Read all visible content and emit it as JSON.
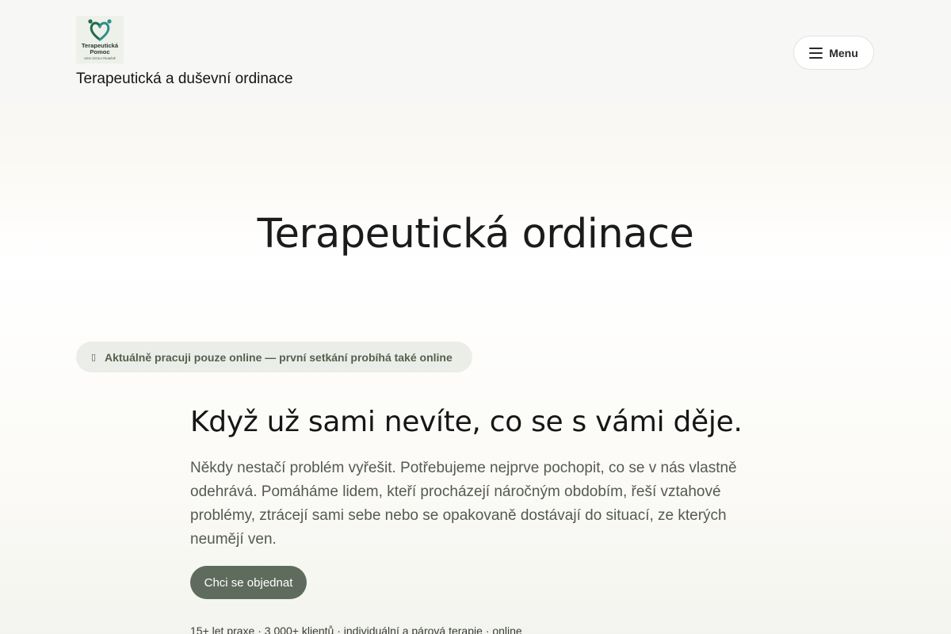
{
  "header": {
    "logo_icon": "heart-people-logo",
    "logo_text_line1": "Terapeutická",
    "logo_text_line2": "Pomoc",
    "logo_text_line3": "VEDE CESTA K PROMĚNĚ",
    "site_title": "Terapeutická a duševní ordinace",
    "menu_label": "Menu",
    "menu_icon": "hamburger-icon"
  },
  "hero": {
    "title": "Terapeutická ordinace"
  },
  "notice": {
    "icon": "info-icon",
    "text": "Aktuálně pracuji pouze online — první setkání probíhá také online"
  },
  "lead": {
    "title": "Když už sami nevíte, co se s vámi děje.",
    "text": "Někdy nestačí problém vyřešit. Potřebujeme nejprve pochopit, co se v nás vlastně odehrává. Pomáháme lidem, kteří procházejí náročným obdobím, řeší vztahové problémy, ztrácejí sami sebe nebo se opakovaně dostávají do situací, ze kterých neumějí ven.",
    "cta_label": "Chci se objednat",
    "stats": "15+ let praxe · 3 000+ klientů · individuální a párová terapie · online"
  },
  "colors": {
    "accent": "#5f6b5d",
    "notice_bg": "#ebeee8",
    "logo_green": "#1f6b4e"
  }
}
